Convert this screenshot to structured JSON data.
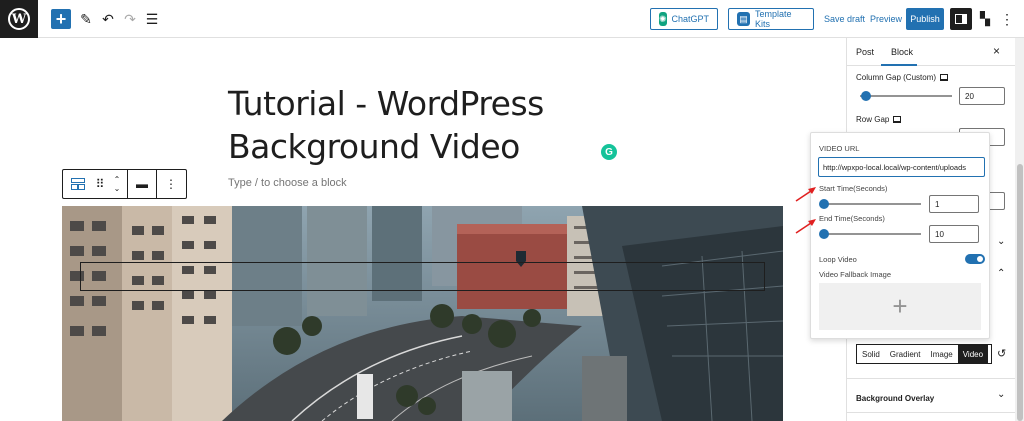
{
  "toolbar": {
    "chatgpt_label": "ChatGPT",
    "template_kits_label": "Template Kits",
    "save_draft_label": "Save draft",
    "preview_label": "Preview",
    "publish_label": "Publish"
  },
  "editor": {
    "title": "Tutorial - WordPress Background Video",
    "placeholder": "Type / to choose a block"
  },
  "sidebar": {
    "tabs": [
      "Post",
      "Block"
    ],
    "close_icon": "×",
    "column_gap_label": "Column Gap (Custom)",
    "column_gap_value": "20",
    "row_gap_label": "Row Gap",
    "background_types": [
      "Solid",
      "Gradient",
      "Image",
      "Video"
    ],
    "active_background_type": "Video",
    "background_overlay_label": "Background Overlay"
  },
  "video_popover": {
    "video_url_label": "VIDEO URL",
    "video_url_value": "http://wpxpo-local.local/wp-content/uploads",
    "start_time_label": "Start Time(Seconds)",
    "start_time_value": "1",
    "end_time_label": "End Time(Seconds)",
    "end_time_value": "10",
    "loop_video_label": "Loop Video",
    "loop_video_on": true,
    "fallback_image_label": "Video Fallback Image",
    "fallback_plus": "+"
  },
  "colors": {
    "accent": "#2271b1",
    "chatgpt_icon": "#10a37f",
    "annotation_arrow": "#e02020"
  }
}
